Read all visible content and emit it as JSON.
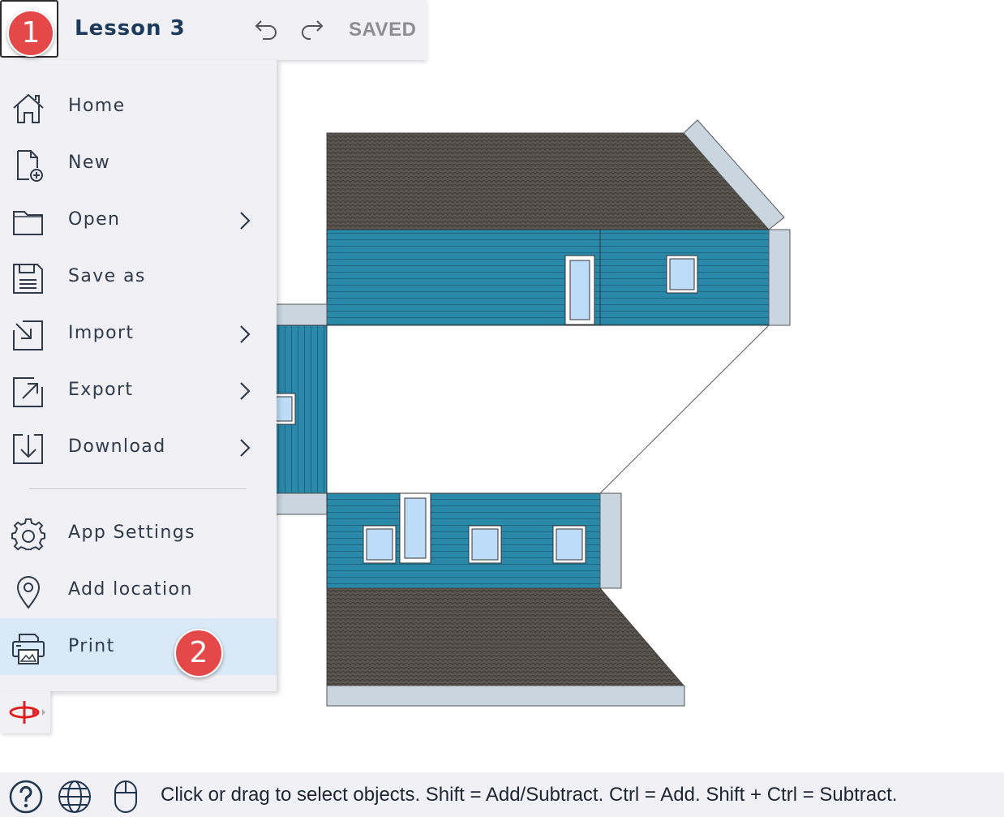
{
  "document": {
    "title": "Lesson 3",
    "save_status": "SAVED"
  },
  "menu": {
    "items": [
      {
        "label": "Home",
        "icon": "home-icon",
        "submenu": false
      },
      {
        "label": "New",
        "icon": "new-file-icon",
        "submenu": false
      },
      {
        "label": "Open",
        "icon": "folder-icon",
        "submenu": true
      },
      {
        "label": "Save as",
        "icon": "save-icon",
        "submenu": false
      },
      {
        "label": "Import",
        "icon": "import-icon",
        "submenu": true
      },
      {
        "label": "Export",
        "icon": "export-icon",
        "submenu": true
      },
      {
        "label": "Download",
        "icon": "download-icon",
        "submenu": true
      },
      {
        "label": "App Settings",
        "icon": "gear-icon",
        "submenu": false
      },
      {
        "label": "Add location",
        "icon": "location-pin-icon",
        "submenu": false
      },
      {
        "label": "Print",
        "icon": "printer-icon",
        "submenu": false,
        "highlighted": true
      }
    ]
  },
  "annotations": {
    "badge_1": "1",
    "badge_2": "2"
  },
  "statusbar": {
    "message": "Click or drag to select objects. Shift = Add/Subtract. Ctrl = Add. Shift + Ctrl = Subtract."
  },
  "colors": {
    "wall": "#2a88a8",
    "roof": "#55504b",
    "trim": "#c9d6df",
    "window": "#bcdcf8",
    "badge": "#e54848",
    "menu_bg": "#f1f1f5",
    "highlight": "#d9e9f7"
  }
}
